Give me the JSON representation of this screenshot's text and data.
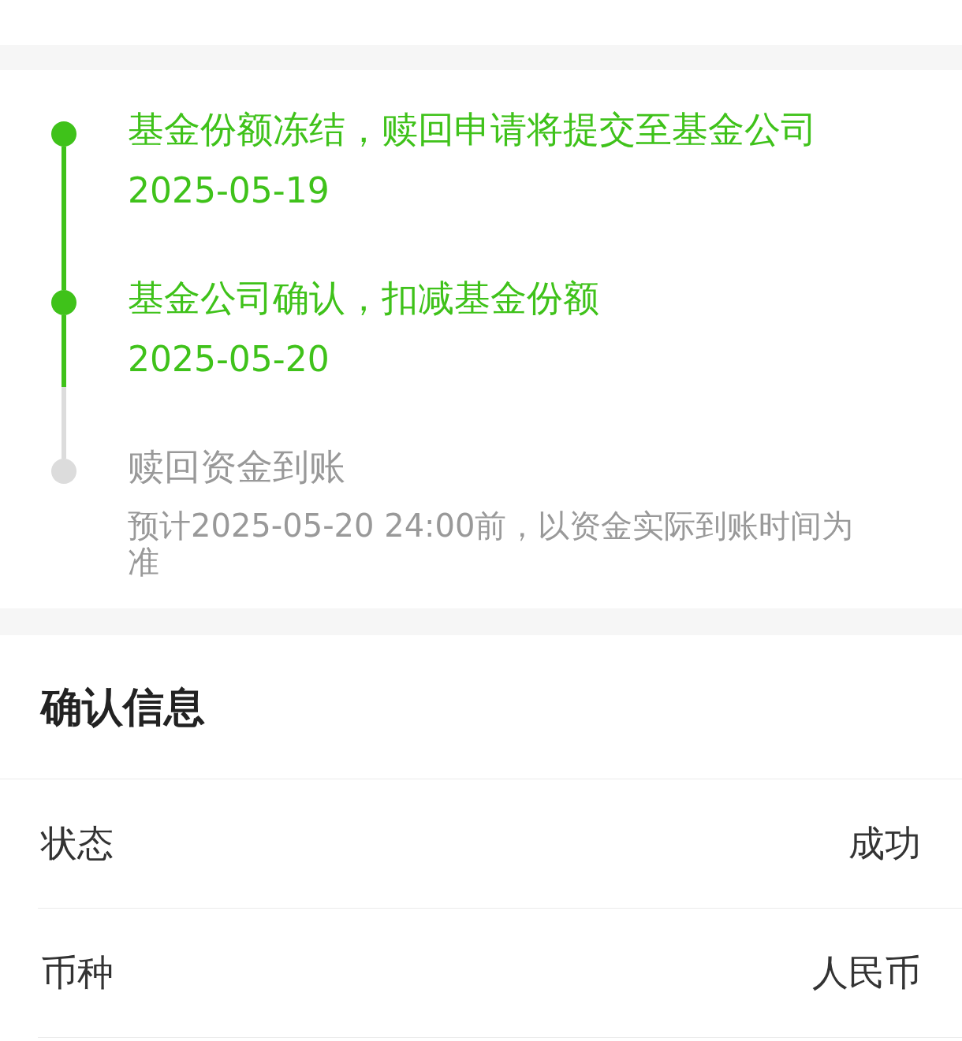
{
  "timeline": [
    {
      "kind": "dated",
      "title": "基金份额冻结，赎回申请将提交至基金公司",
      "date": "2025-05-19",
      "done": true
    },
    {
      "kind": "dated",
      "title": "基金公司确认，扣减基金份额",
      "date": "2025-05-20",
      "done": true
    },
    {
      "kind": "noted",
      "title": "赎回资金到账",
      "note": "预计2025-05-20 24:00前，以资金实际到账时间为准",
      "done": false
    }
  ],
  "confirm_info": {
    "title": "确认信息",
    "rows": [
      {
        "label": "状态",
        "value": "成功"
      },
      {
        "label": "币种",
        "value": "人民币"
      }
    ]
  }
}
